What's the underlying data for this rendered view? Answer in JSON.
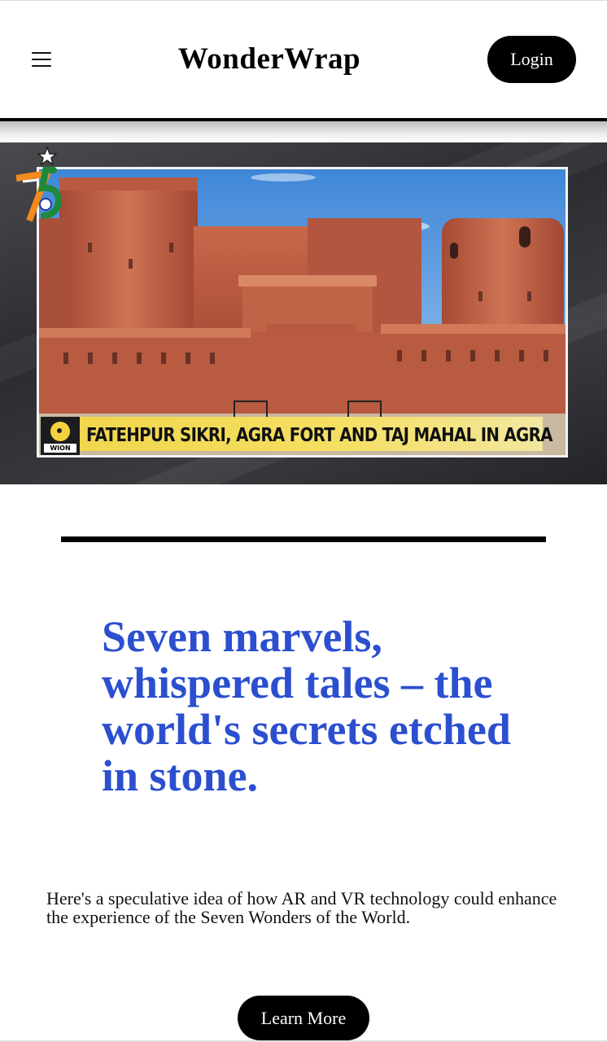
{
  "header": {
    "brand": "WonderWrap",
    "login_label": "Login",
    "menu_icon": "hamburger-menu-icon"
  },
  "hero": {
    "caption": "FATEHPUR SIKRI, AGRA FORT AND TAJ MAHAL IN AGRA",
    "channel_logo_text": "WION",
    "badge_icon": "india-75-badge-icon"
  },
  "main": {
    "tagline": "Seven marvels, whispered tales – the world's secrets etched in stone.",
    "description": "Here's a speculative idea of how AR and VR technology could enhance the experience of the Seven Wonders of the World.",
    "learn_more_label": "Learn More"
  },
  "colors": {
    "tagline": "#2b4fcf",
    "button_bg": "#000000",
    "caption_bar": "#f0d54a",
    "fort_stone": "#b9553a"
  }
}
